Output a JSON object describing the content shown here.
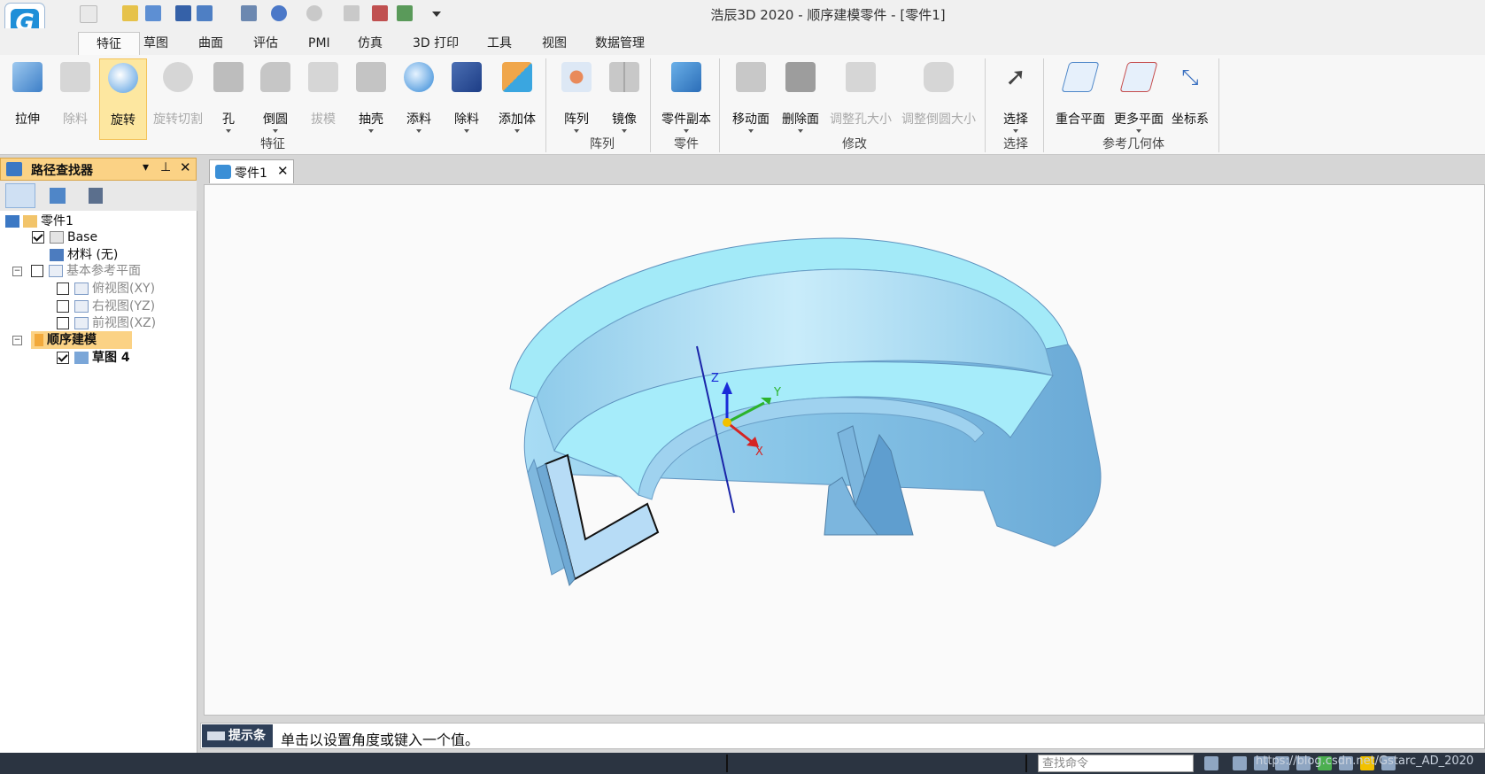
{
  "window": {
    "title": "浩辰3D 2020 - 顺序建模零件 - [零件1]",
    "logo": "G"
  },
  "ribbon_tabs": [
    {
      "label": "特征",
      "active": true
    },
    {
      "label": "草图"
    },
    {
      "label": "曲面"
    },
    {
      "label": "评估"
    },
    {
      "label": "PMI"
    },
    {
      "label": "仿真"
    },
    {
      "label": "3D 打印"
    },
    {
      "label": "工具"
    },
    {
      "label": "视图"
    },
    {
      "label": "数据管理"
    }
  ],
  "ribbon": {
    "buttons": [
      {
        "label": "拉伸",
        "icon": "extrude-icon"
      },
      {
        "label": "除料",
        "icon": "cut-icon",
        "disabled": true
      },
      {
        "label": "旋转",
        "icon": "revolve-icon",
        "selected": true
      },
      {
        "label": "旋转切割",
        "icon": "revolve-cut-icon",
        "disabled": true
      },
      {
        "label": "孔",
        "icon": "hole-icon"
      },
      {
        "label": "倒圆",
        "icon": "fillet-icon"
      },
      {
        "label": "拔模",
        "icon": "draft-icon",
        "disabled": true
      },
      {
        "label": "抽壳",
        "icon": "shell-icon"
      },
      {
        "label": "添料",
        "icon": "add-material-icon"
      },
      {
        "label": "除料",
        "icon": "remove-material-icon"
      },
      {
        "label": "添加体",
        "icon": "add-body-icon"
      },
      {
        "label": "阵列",
        "icon": "pattern-icon"
      },
      {
        "label": "镜像",
        "icon": "mirror-icon"
      },
      {
        "label": "零件副本",
        "icon": "part-copy-icon"
      },
      {
        "label": "移动面",
        "icon": "move-face-icon"
      },
      {
        "label": "删除面",
        "icon": "delete-face-icon"
      },
      {
        "label": "调整孔大小",
        "icon": "resize-hole-icon",
        "disabled": true
      },
      {
        "label": "调整倒圆大小",
        "icon": "resize-fillet-icon",
        "disabled": true
      },
      {
        "label": "选择",
        "icon": "select-arrow-icon"
      },
      {
        "label": "重合平面",
        "icon": "coincident-plane-icon"
      },
      {
        "label": "更多平面",
        "icon": "more-planes-icon"
      },
      {
        "label": "坐标系",
        "icon": "coordinate-system-icon"
      }
    ],
    "groups": [
      "特征",
      "阵列",
      "零件",
      "修改",
      "选择",
      "参考几何体"
    ]
  },
  "left_panel": {
    "title": "路径查找器",
    "tree": {
      "root": "零件1",
      "base": "Base",
      "material": "材料 (无)",
      "ref_planes": "基本参考平面",
      "plane_xy": "俯视图(XY)",
      "plane_yz": "右视图(YZ)",
      "plane_xz": "前视图(XZ)",
      "seq_model": "顺序建模",
      "sketch": "草图 4"
    }
  },
  "document": {
    "tab_label": "零件1"
  },
  "axes": {
    "x": "X",
    "y": "Y",
    "z": "Z"
  },
  "prompt": {
    "label": "提示条",
    "message": "单击以设置角度或键入一个值。"
  },
  "status": {
    "search_placeholder": "查找命令",
    "watermark": "https://blog.csdn.net/Gstarc_AD_2020"
  },
  "colors": {
    "selected_tab_bg": "#fde7a0",
    "panel_header": "#fbd285",
    "model_fill": "#9fd8ee",
    "status_bg": "#2b3441"
  }
}
